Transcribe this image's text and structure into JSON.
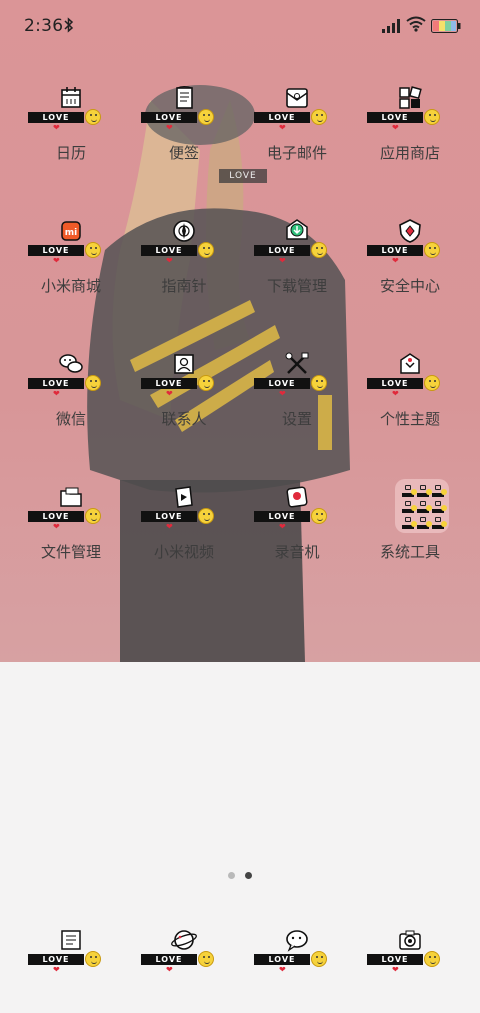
{
  "status_bar": {
    "time": "2:36",
    "icons": [
      "bluetooth-icon",
      "signal-icon",
      "wifi-icon",
      "battery-icon"
    ]
  },
  "love_badge": "LOVE",
  "floating_tag": "LOVE",
  "apps": [
    {
      "label": "日历",
      "icon": "calendar-icon"
    },
    {
      "label": "便签",
      "icon": "notes-icon"
    },
    {
      "label": "电子邮件",
      "icon": "email-icon"
    },
    {
      "label": "应用商店",
      "icon": "app-store-icon"
    },
    {
      "label": "小米商城",
      "icon": "mi-store-icon"
    },
    {
      "label": "指南针",
      "icon": "compass-icon"
    },
    {
      "label": "下载管理",
      "icon": "download-icon"
    },
    {
      "label": "安全中心",
      "icon": "security-icon"
    },
    {
      "label": "微信",
      "icon": "wechat-icon"
    },
    {
      "label": "联系人",
      "icon": "contacts-icon"
    },
    {
      "label": "设置",
      "icon": "settings-icon"
    },
    {
      "label": "个性主题",
      "icon": "themes-icon"
    },
    {
      "label": "文件管理",
      "icon": "file-manager-icon"
    },
    {
      "label": "小米视频",
      "icon": "video-icon"
    },
    {
      "label": "录音机",
      "icon": "recorder-icon"
    },
    {
      "label": "系统工具",
      "icon": "folder-icon"
    }
  ],
  "dock": [
    {
      "icon": "phone-icon"
    },
    {
      "icon": "browser-icon"
    },
    {
      "icon": "messages-icon"
    },
    {
      "icon": "camera-icon"
    }
  ],
  "pages": {
    "count": 2,
    "current": 2
  },
  "colors": {
    "wallpaper": "#d88c8f",
    "lower": "#f4f3f3",
    "badge": "#111111",
    "heart": "#e02a3c",
    "smiley": "#f6d23b"
  }
}
